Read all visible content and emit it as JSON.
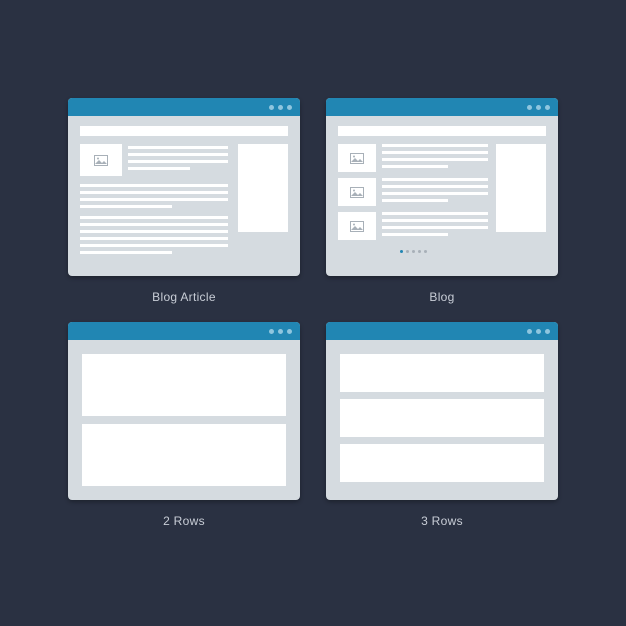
{
  "templates": [
    {
      "label": "Blog Article"
    },
    {
      "label": "Blog"
    },
    {
      "label": "2 Rows"
    },
    {
      "label": "3 Rows"
    }
  ],
  "colors": {
    "bg": "#2a3142",
    "accent": "#2186b3",
    "panel": "#d5dbe0",
    "box": "#ffffff"
  },
  "image_icon": "picture-placeholder"
}
